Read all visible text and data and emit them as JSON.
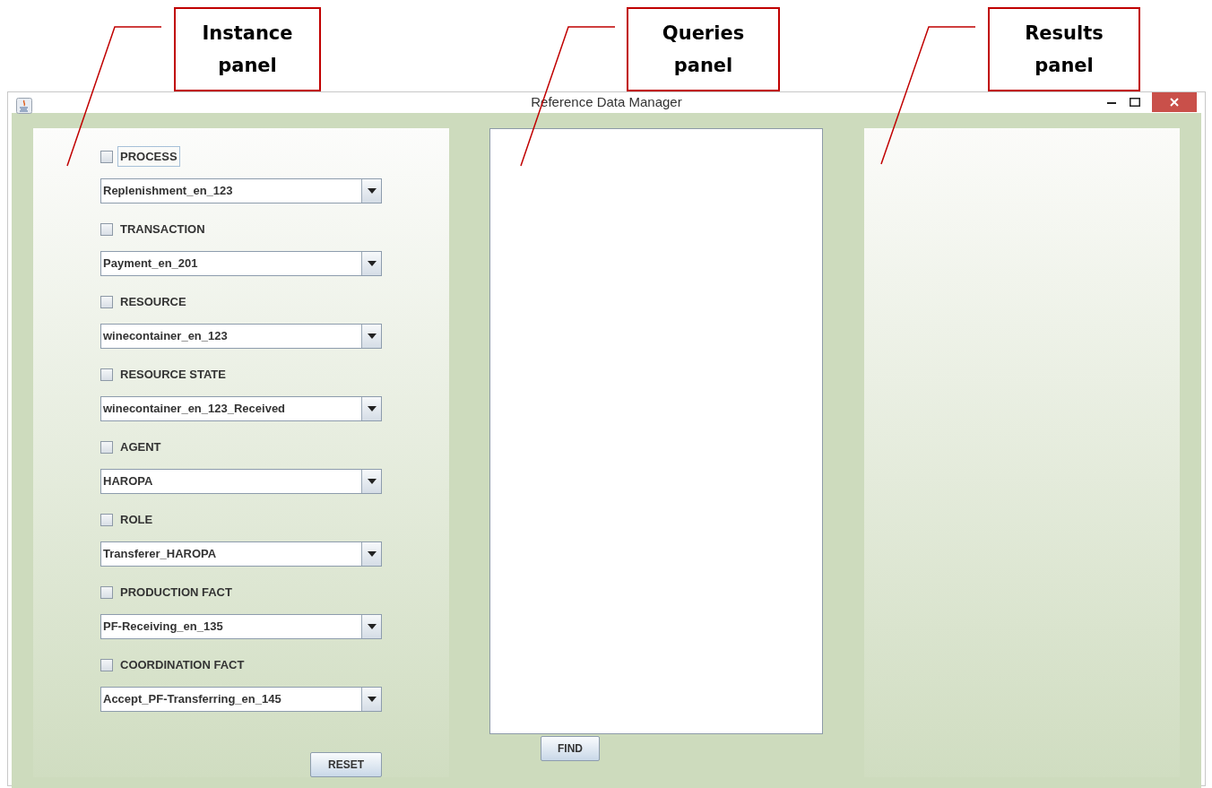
{
  "annotations": [
    {
      "label": "Instance panel"
    },
    {
      "label": "Queries panel"
    },
    {
      "label": "Results panel"
    }
  ],
  "window": {
    "title": "Reference Data Manager"
  },
  "filters": [
    {
      "label": "PROCESS",
      "checked": false,
      "focused": true,
      "value": "Replenishment_en_123"
    },
    {
      "label": "TRANSACTION",
      "checked": false,
      "focused": false,
      "value": "Payment_en_201"
    },
    {
      "label": "RESOURCE",
      "checked": false,
      "focused": false,
      "value": "winecontainer_en_123"
    },
    {
      "label": "RESOURCE STATE",
      "checked": false,
      "focused": false,
      "value": "winecontainer_en_123_Received"
    },
    {
      "label": "AGENT",
      "checked": false,
      "focused": false,
      "value": "HAROPA"
    },
    {
      "label": "ROLE",
      "checked": false,
      "focused": false,
      "value": "Transferer_HAROPA"
    },
    {
      "label": "PRODUCTION FACT",
      "checked": false,
      "focused": false,
      "value": "PF-Receiving_en_135"
    },
    {
      "label": "COORDINATION FACT",
      "checked": false,
      "focused": false,
      "value": "Accept_PF-Transferring_en_145"
    }
  ],
  "reset_button": "RESET",
  "find_button": "FIND"
}
